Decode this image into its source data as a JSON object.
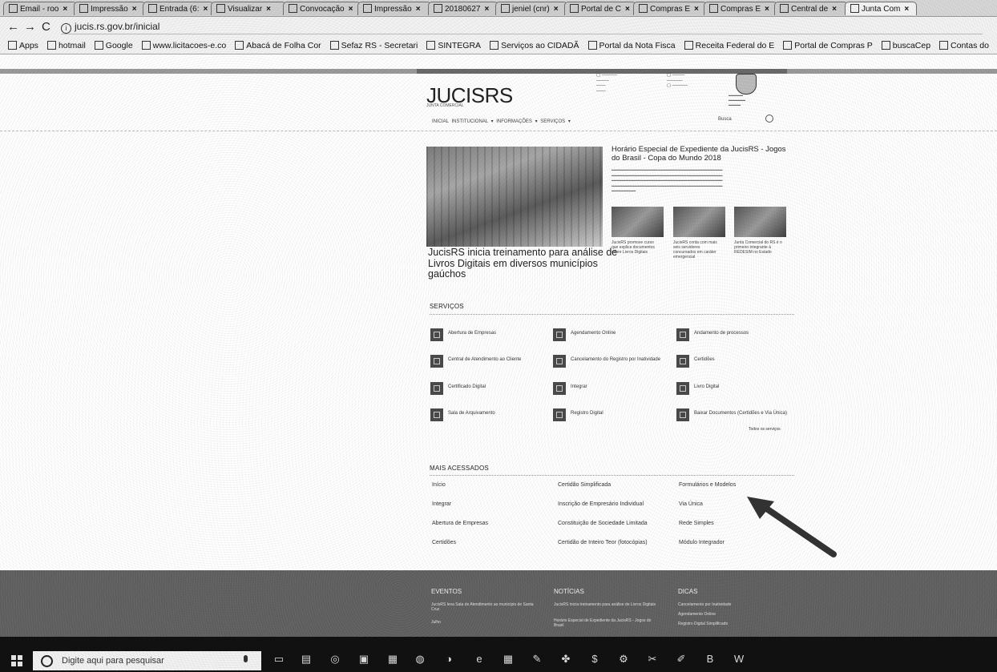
{
  "browser": {
    "tabs": [
      {
        "label": "Email - roo",
        "icon": "mail-icon"
      },
      {
        "label": "Impressão",
        "icon": "page-icon"
      },
      {
        "label": "Entrada (6:",
        "icon": "gmail-icon"
      },
      {
        "label": "Visualizar",
        "icon": "page-icon"
      },
      {
        "label": "Convocação",
        "icon": "page-icon"
      },
      {
        "label": "Impressão",
        "icon": "page-icon"
      },
      {
        "label": "20180627",
        "icon": "page-icon"
      },
      {
        "label": "jeniel (cnr)",
        "icon": "page-icon"
      },
      {
        "label": "Portal de C",
        "icon": "portal-icon"
      },
      {
        "label": "Compras E",
        "icon": "grid-icon"
      },
      {
        "label": "Compras E",
        "icon": "grid-icon"
      },
      {
        "label": "Central de",
        "icon": "crest-icon"
      },
      {
        "label": "Junta Com",
        "icon": "crest-icon",
        "active": true
      }
    ],
    "url": "jucis.rs.gov.br/inicial",
    "bookmarks": [
      {
        "label": "Apps",
        "icon": "apps-icon"
      },
      {
        "label": "hotmail",
        "icon": "mail-icon"
      },
      {
        "label": "Google",
        "icon": "google-icon"
      },
      {
        "label": "www.licitacoes-e.co",
        "icon": "bb-icon"
      },
      {
        "label": "Abacá de Folha Cor",
        "icon": "m-icon"
      },
      {
        "label": "Sefaz RS - Secretari",
        "icon": "sefaz-icon"
      },
      {
        "label": "SINTEGRA",
        "icon": "page-icon"
      },
      {
        "label": "Serviços ao CIDADÃ",
        "icon": "page-icon"
      },
      {
        "label": "Portal da Nota Fisca",
        "icon": "page-icon"
      },
      {
        "label": "Receita Federal do E",
        "icon": "receita-icon"
      },
      {
        "label": "Portal de Compras P",
        "icon": "page-icon"
      },
      {
        "label": "buscaCep",
        "icon": "cep-icon"
      },
      {
        "label": "Contas do",
        "icon": "google-icon"
      }
    ]
  },
  "site": {
    "logo": "JUCISRS",
    "nav": "INICIAL   INSTITUCIONAL ▾   INFORMAÇÕES ▾   SERVIÇOS ▾",
    "search_label": "Busca",
    "hero_title": "JucisRS inicia treinamento para análise de Livros Digitais em diversos municípios gaúchos",
    "featured_title": "Horário Especial de Expediente da JucisRS - Jogos do Brasil - Copa do Mundo 2018",
    "thumbs": [
      "JucisRS promove curso que explica documentos sobre Livros Digitais",
      "JucisRS conta com mais seis servidores concursados em caráter emergencial",
      "Junta Comercial do RS é o primeiro integrante à REDESIM no Estado"
    ],
    "servicos_title": "SERVIÇOS",
    "servicos": [
      {
        "label": "Abertura de Empresas",
        "icon": "building-icon"
      },
      {
        "label": "Agendamento Online",
        "icon": "calendar-icon"
      },
      {
        "label": "Andamento de processos",
        "icon": "process-icon"
      },
      {
        "label": "Central de Atendimento ao Cliente",
        "icon": "support-icon"
      },
      {
        "label": "Cancelamento do Registro por Inatividade",
        "icon": "cancel-icon"
      },
      {
        "label": "Certidões",
        "icon": "certificate-icon"
      },
      {
        "label": "Certificado Digital",
        "icon": "digital-cert-icon"
      },
      {
        "label": "Integrar",
        "icon": "integrate-icon"
      },
      {
        "label": "Livro Digital",
        "icon": "book-icon"
      },
      {
        "label": "Sala de Arquivamento",
        "icon": "archive-icon"
      },
      {
        "label": "Registro Digital",
        "icon": "register-icon"
      },
      {
        "label": "Baixar Documentos (Certidões e Via Única)",
        "icon": "download-icon"
      }
    ],
    "todos_servicos": "Todos os serviços",
    "mais_title": "MAIS ACESSADOS",
    "mais": [
      [
        "Início",
        "Certidão Simplificada",
        "Formulários e Modelos"
      ],
      [
        "Integrar",
        "Inscrição de Empresário Individual",
        "Via Única"
      ],
      [
        "Abertura de Empresas",
        "Constituição de Sociedade Limitada",
        "Rede Simples"
      ],
      [
        "Certidões",
        "Certidão de Inteiro Teor (fotocópias)",
        "Módulo Integrador"
      ]
    ],
    "footer": {
      "eventos_title": "EVENTOS",
      "eventos": [
        "JucisRS leva Sala de Atendimento ao município de Santa Cruz",
        "Julho"
      ],
      "noticias_title": "NOTÍCIAS",
      "noticias": [
        "JucisRS inicia treinamento para análise de Livros Digitais",
        "Horário Especial de Expediente da JucisRS - Jogos do Brasil"
      ],
      "dicas_title": "DICAS",
      "dicas": [
        "Cancelamento por Inatividade",
        "Agendamento Online",
        "Registro Digital Simplificado"
      ]
    }
  },
  "taskbar": {
    "search_placeholder": "Digite aqui para pesquisar"
  }
}
